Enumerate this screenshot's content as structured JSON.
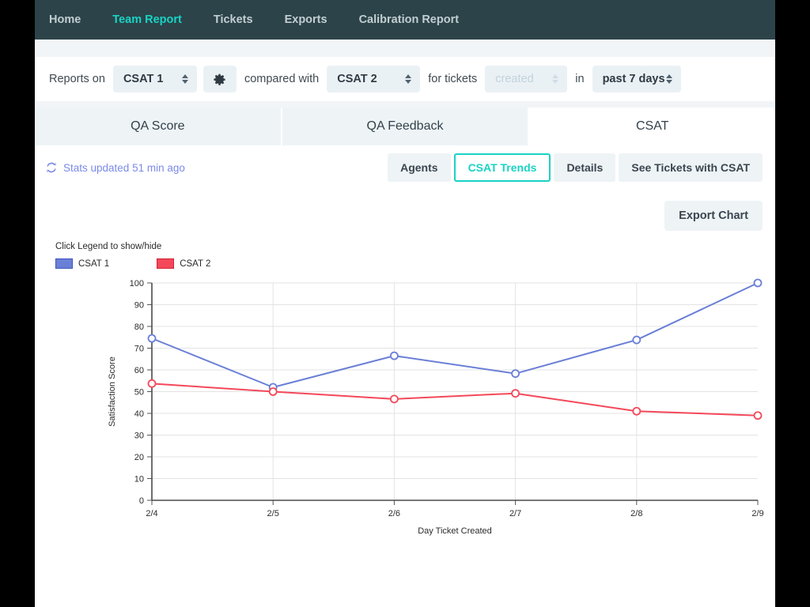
{
  "nav": {
    "items": [
      {
        "label": "Home",
        "active": false
      },
      {
        "label": "Team Report",
        "active": true
      },
      {
        "label": "Tickets",
        "active": false
      },
      {
        "label": "Exports",
        "active": false
      },
      {
        "label": "Calibration Report",
        "active": false
      }
    ]
  },
  "filters": {
    "reports_on_label": "Reports on",
    "metric_primary": "CSAT 1",
    "settings_icon": "gear-icon",
    "compared_with_label": "compared with",
    "metric_secondary": "CSAT 2",
    "for_tickets_label": "for tickets",
    "ticket_event": "created",
    "in_label": "in",
    "date_range": "past 7 days"
  },
  "tabs": [
    {
      "label": "QA Score",
      "active": false
    },
    {
      "label": "QA Feedback",
      "active": false
    },
    {
      "label": "CSAT",
      "active": true
    }
  ],
  "subbar": {
    "refresh_icon": "refresh-icon",
    "stats_updated": "Stats updated 51 min ago",
    "segments": [
      {
        "label": "Agents",
        "selected": false
      },
      {
        "label": "CSAT Trends",
        "selected": true
      },
      {
        "label": "Details",
        "selected": false
      },
      {
        "label": "See Tickets with CSAT",
        "selected": false
      }
    ]
  },
  "export": {
    "label": "Export Chart"
  },
  "chart_data": {
    "type": "line",
    "title": "",
    "legend_hint": "Click Legend to show/hide",
    "legend_position": "top-left",
    "xlabel": "Day Ticket Created",
    "ylabel": "Satisfaction Score",
    "categories": [
      "2/4",
      "2/5",
      "2/6",
      "2/7",
      "2/8",
      "2/9"
    ],
    "ylim": [
      0,
      100
    ],
    "yticks": [
      0,
      10,
      20,
      30,
      40,
      50,
      60,
      70,
      80,
      90,
      100
    ],
    "grid": true,
    "series": [
      {
        "name": "CSAT 1",
        "color": "#6a7fd6",
        "values": [
          74.5,
          52.0,
          66.5,
          58.3,
          73.8,
          100.0
        ]
      },
      {
        "name": "CSAT 2",
        "color": "#f4485a",
        "values": [
          53.7,
          50.0,
          46.6,
          49.2,
          41.0,
          39.0
        ]
      }
    ]
  },
  "colors": {
    "nav_background": "#2c4449",
    "accent_teal": "#19d3c5",
    "stats_blue": "#7b8ae8",
    "series1": "#6a7fd6",
    "series2": "#f4485a"
  }
}
